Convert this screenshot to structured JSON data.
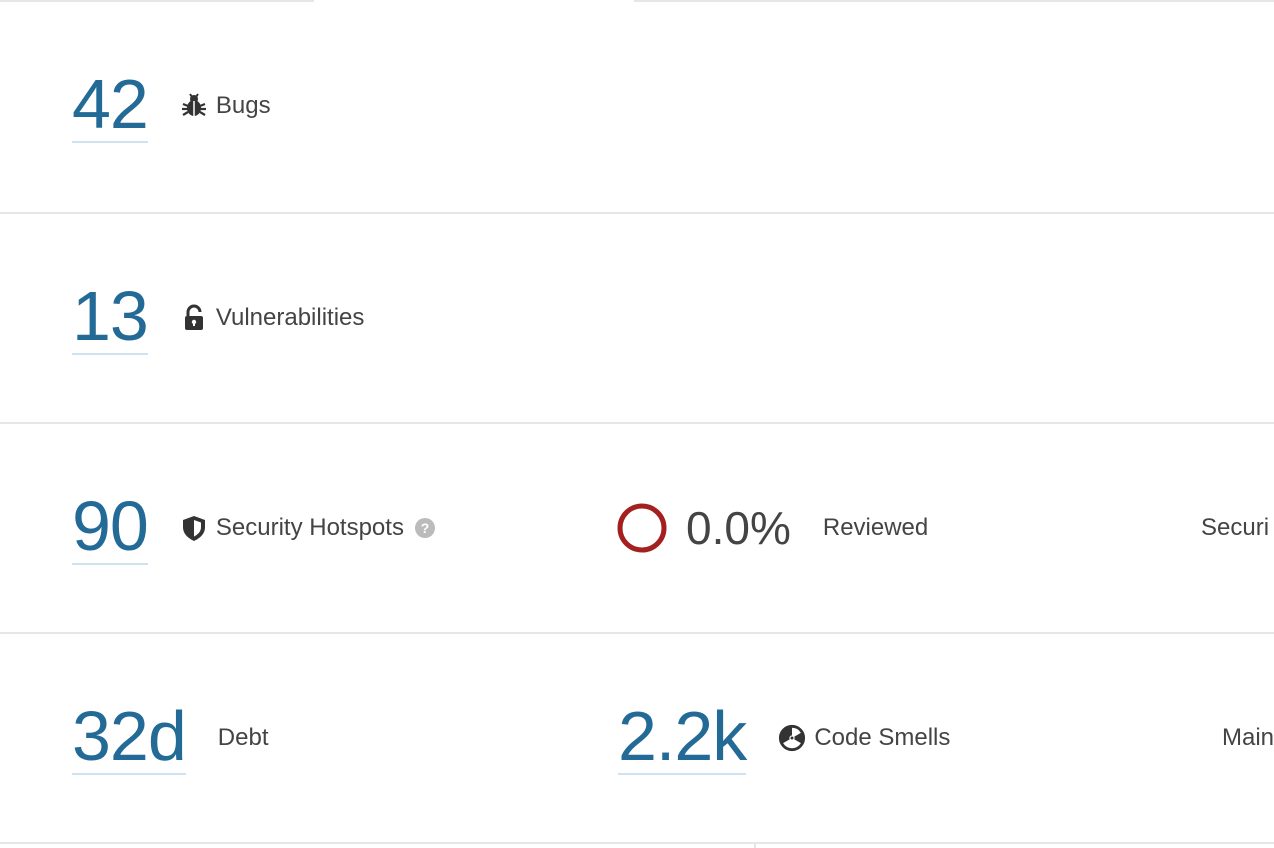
{
  "metrics": {
    "bugs": {
      "value": "42",
      "label": "Bugs"
    },
    "vulnerabilities": {
      "value": "13",
      "label": "Vulnerabilities"
    },
    "hotspots": {
      "value": "90",
      "label": "Security Hotspots",
      "reviewed_value": "0.0%",
      "reviewed_label": "Reviewed",
      "trunc_label": "Securi"
    },
    "debt": {
      "value": "32d",
      "label": "Debt"
    },
    "code_smells": {
      "value": "2.2k",
      "label": "Code Smells",
      "trunc_label": "Main"
    }
  },
  "colors": {
    "value_link": "#236a97",
    "rating_ring": "#a4201f",
    "border": "#e6e6e6"
  },
  "icons": {
    "bugs": "bug-icon",
    "vulnerabilities": "unlock-icon",
    "hotspots": "shield-icon",
    "help": "help-icon",
    "rating": "ring-icon",
    "code_smells": "radiation-icon"
  }
}
